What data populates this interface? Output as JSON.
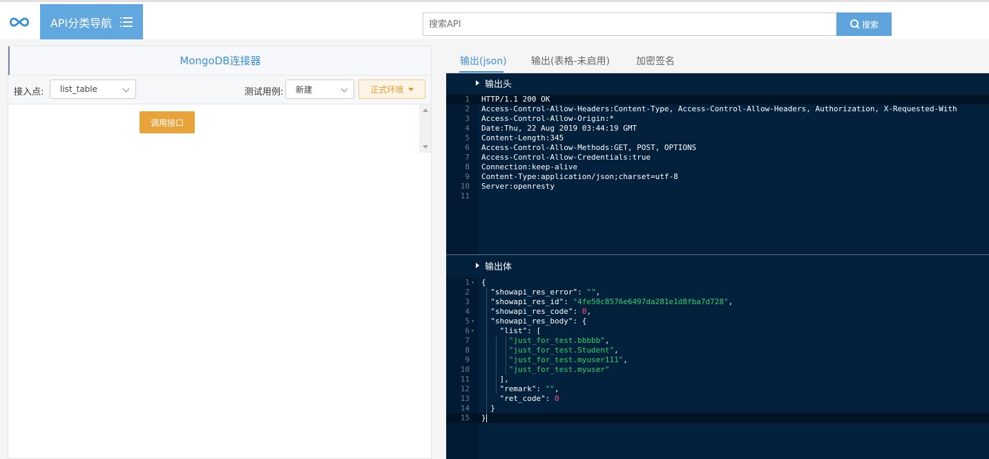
{
  "header": {
    "nav_label": "API分类导航",
    "search_placeholder": "搜索API",
    "search_button": "搜索"
  },
  "left": {
    "title": "MongoDB连接器",
    "endpoint_label": "接入点:",
    "endpoint_value": "list_table",
    "testcase_label": "测试用例:",
    "testcase_value": "新建",
    "env_label": "正式环境",
    "call_button": "调用接口"
  },
  "right": {
    "tabs": [
      "输出(json)",
      "输出(表格-未启用)",
      "加密签名"
    ],
    "header_section": "输出头",
    "body_section": "输出体",
    "header_lines": [
      "HTTP/1.1 200 OK",
      "Access-Control-Allow-Headers:Content-Type, Access-Control-Allow-Headers, Authorization, X-Requested-With",
      "Access-Control-Allow-Origin:*",
      "Date:Thu, 22 Aug 2019 03:44:19 GMT",
      "Content-Length:345",
      "Access-Control-Allow-Methods:GET, POST, OPTIONS",
      "Access-Control-Allow-Credentials:true",
      "Connection:keep-alive",
      "Content-Type:application/json;charset=utf-8",
      "Server:openresty",
      ""
    ],
    "body_lines": [
      "{",
      "  \"showapi_res_error\": \"\",",
      "  \"showapi_res_id\": \"4fe50c8576e6497da281e1d8fba7d728\",",
      "  \"showapi_res_code\": 0,",
      "  \"showapi_res_body\": {",
      "    \"list\": [",
      "      \"just_for_test.bbbbb\",",
      "      \"just_for_test.Student\",",
      "      \"just_for_test.myuser111\",",
      "      \"just_for_test.myuser\"",
      "    ],",
      "    \"remark\": \"\",",
      "    \"ret_code\": 0",
      "  }",
      "}"
    ]
  }
}
